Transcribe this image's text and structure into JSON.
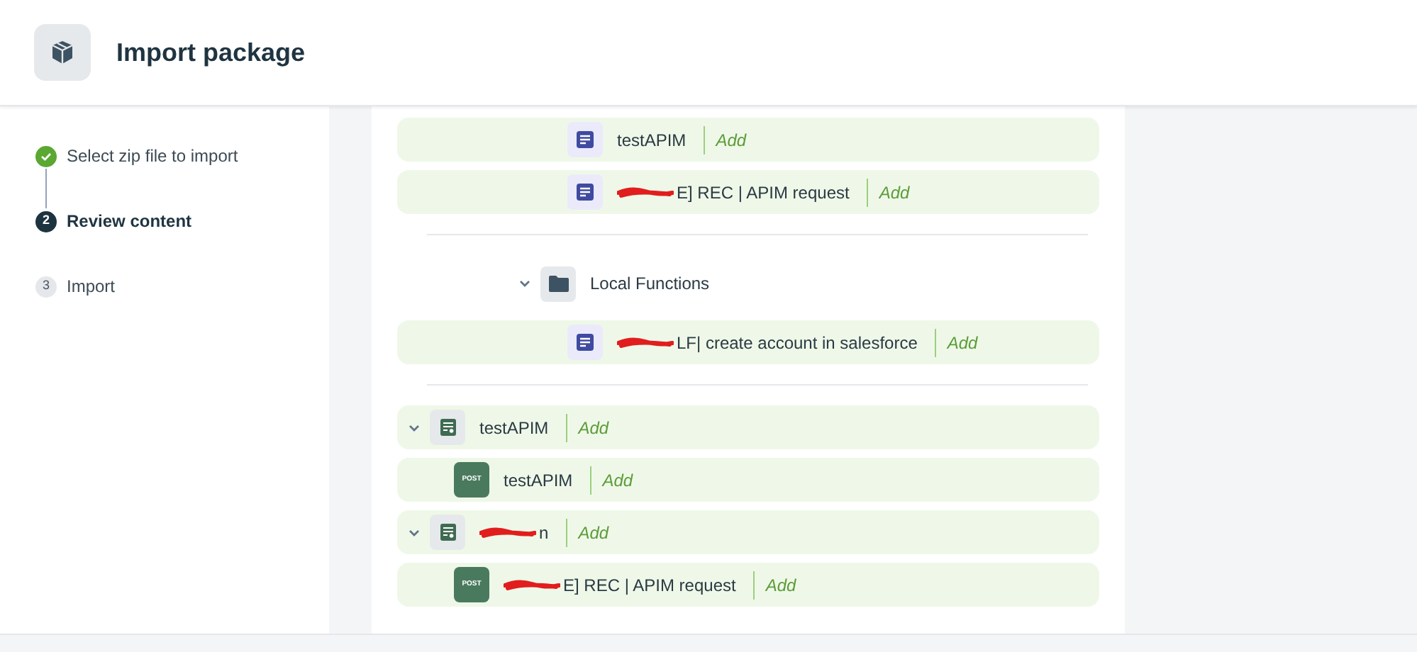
{
  "header": {
    "title": "Import package"
  },
  "steps": [
    {
      "label": "Select zip file to import",
      "done": true,
      "selected": false
    },
    {
      "number": "2",
      "label": "Review content",
      "done": false,
      "selected": true
    },
    {
      "number": "3",
      "label": "Import",
      "done": false,
      "selected": false
    }
  ],
  "sections": [
    {
      "items": [
        {
          "kind": "doc",
          "name": "testAPIM",
          "redacted": false,
          "action": "Add"
        },
        {
          "kind": "doc",
          "name": "E] REC | APIM request",
          "redacted": true,
          "action": "Add"
        }
      ]
    },
    {
      "items": [
        {
          "kind": "folder",
          "name": "Local Functions",
          "expanded": true,
          "children": [
            {
              "kind": "doc",
              "name": "LF| create account in salesforce",
              "redacted": true,
              "action": "Add"
            }
          ]
        }
      ]
    },
    {
      "items": [
        {
          "kind": "api",
          "name": "testAPIM",
          "redacted": false,
          "action": "Add",
          "expanded": true,
          "children": [
            {
              "kind": "post",
              "badge": "POST",
              "name": "testAPIM",
              "redacted": false,
              "action": "Add"
            }
          ]
        },
        {
          "kind": "api",
          "name": "n",
          "redacted": true,
          "action": "Add",
          "expanded": true,
          "children": [
            {
              "kind": "post",
              "badge": "POST",
              "name": "E] REC | APIM request",
              "redacted": true,
              "action": "Add"
            }
          ]
        }
      ]
    }
  ]
}
